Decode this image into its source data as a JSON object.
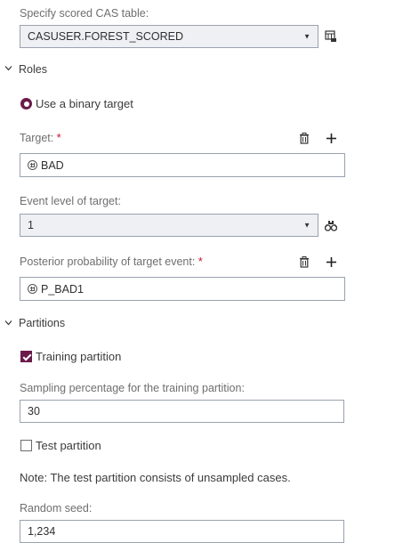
{
  "scored_table": {
    "label": "Specify scored CAS table:",
    "value": "CASUSER.FOREST_SCORED"
  },
  "roles": {
    "header": "Roles",
    "binary_target_label": "Use a binary target",
    "target": {
      "label": "Target:",
      "required": "*",
      "value": "BAD"
    },
    "event_level": {
      "label": "Event level of target:",
      "value": "1"
    },
    "posterior": {
      "label": "Posterior probability of target event:",
      "required": "*",
      "value": "P_BAD1"
    }
  },
  "partitions": {
    "header": "Partitions",
    "training_label": "Training partition",
    "training_checked": true,
    "sampling_label": "Sampling percentage for the training partition:",
    "sampling_value": "30",
    "test_label": "Test partition",
    "test_checked": false,
    "note": "Note: The test partition consists of unsampled cases.",
    "seed_label": "Random seed:",
    "seed_value": "1,234"
  },
  "colors": {
    "accent": "#6b1a4a",
    "required": "#c8102e",
    "select_bg": "#eef0f4",
    "border": "#9aa2ae"
  },
  "icons": {
    "table_browse": "table-icon",
    "delete": "trash-icon",
    "add": "plus-icon",
    "find": "binoculars-icon",
    "variable": "variable-icon",
    "collapse": "chevron-down-icon",
    "dropdown": "caret-down-icon"
  }
}
